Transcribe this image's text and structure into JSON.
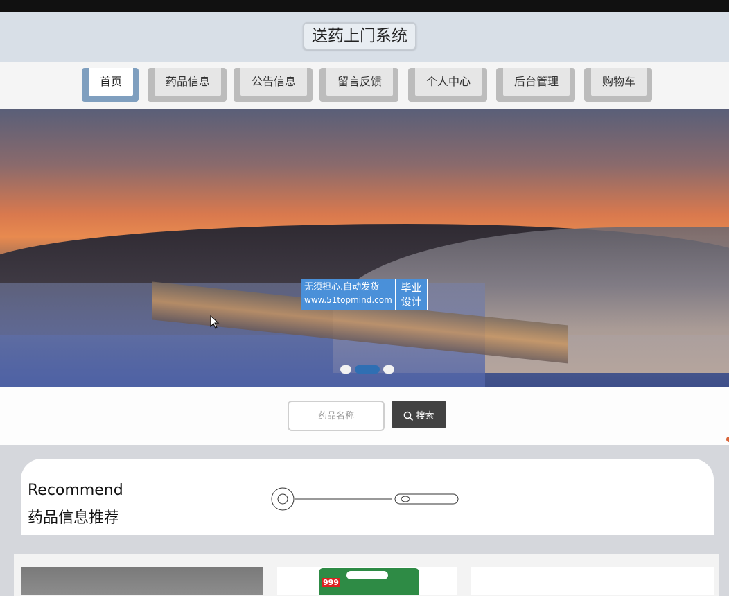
{
  "site": {
    "title": "送药上门系统"
  },
  "nav": {
    "items": [
      {
        "label": "首页",
        "active": true
      },
      {
        "label": "药品信息",
        "active": false
      },
      {
        "label": "公告信息",
        "active": false
      },
      {
        "label": "留言反馈",
        "active": false
      },
      {
        "label": "个人中心",
        "active": false
      },
      {
        "label": "后台管理",
        "active": false
      },
      {
        "label": "购物车",
        "active": false
      }
    ]
  },
  "banner": {
    "watermark_line1": "无须担心.自动发货",
    "watermark_line2": "www.51topmind.com",
    "watermark_tag1": "毕业",
    "watermark_tag2": "设计",
    "slide_count": 3,
    "active_slide": 2
  },
  "search": {
    "placeholder": "药品名称",
    "value": "",
    "button_label": "搜索",
    "button_icon": "search-icon"
  },
  "recommend": {
    "title_en": "Recommend",
    "title_cn": "药品信息推荐"
  },
  "products": {
    "card2_brand": "999"
  },
  "colors": {
    "nav_active_accent": "#7f9fbf",
    "nav_inactive": "#bcbcbc",
    "search_button": "#424242",
    "watermark": "#4a90d9",
    "slider_active": "#2f6fb3"
  }
}
